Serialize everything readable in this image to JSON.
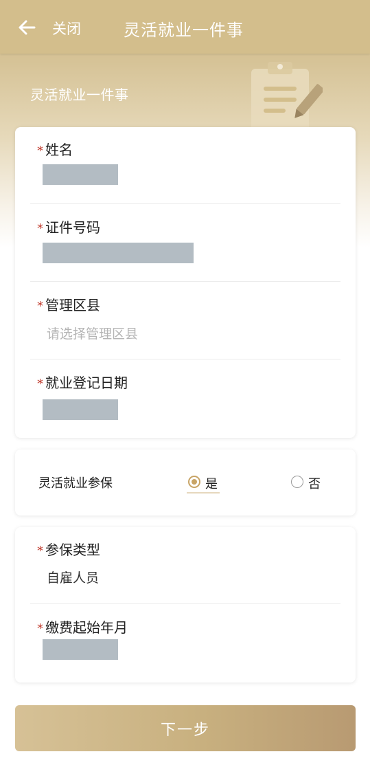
{
  "colors": {
    "header_bg": "#d3be8c",
    "accent_gold": "#c8a466",
    "required_mark": "#c0392b",
    "redaction": "#b3bcc3",
    "button_gradient_start": "#d6c196",
    "button_gradient_end": "#b89a72"
  },
  "navbar": {
    "back_icon": "arrow-left-icon",
    "close_label": "关闭",
    "title": "灵活就业一件事"
  },
  "hero": {
    "subtitle": "灵活就业一件事",
    "illustration_icon": "clipboard-pencil-icon"
  },
  "personal_info": {
    "required_mark": "*",
    "name": {
      "label": "姓名",
      "value_redacted": true
    },
    "id_number": {
      "label": "证件号码",
      "value_redacted": true
    },
    "district": {
      "label": "管理区县",
      "placeholder": "请选择管理区县"
    },
    "employment_reg_date": {
      "label": "就业登记日期",
      "value_redacted": true
    }
  },
  "insurance_toggle": {
    "label": "灵活就业参保",
    "options": [
      {
        "label": "是",
        "selected": true
      },
      {
        "label": "否",
        "selected": false
      }
    ]
  },
  "insurance_info": {
    "required_mark": "*",
    "insurance_type": {
      "label": "参保类型",
      "value": "自雇人员"
    },
    "payment_start": {
      "label": "缴费起始年月",
      "value_redacted": true
    }
  },
  "footer": {
    "next_label": "下一步"
  }
}
